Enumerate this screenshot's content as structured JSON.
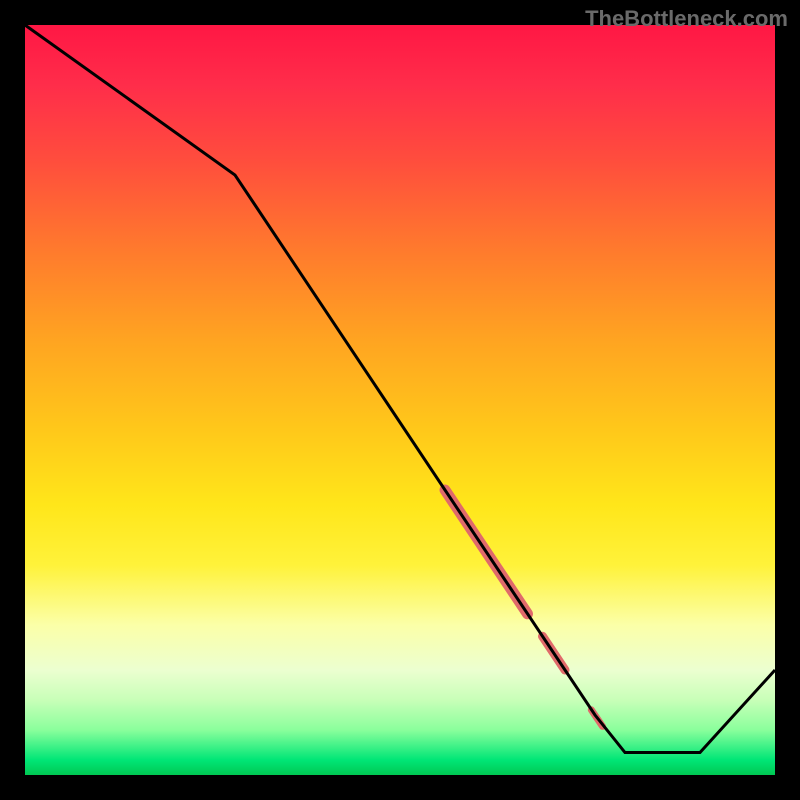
{
  "watermark": "TheBottleneck.com",
  "chart_data": {
    "type": "line",
    "title": "",
    "xlabel": "",
    "ylabel": "",
    "xlim": [
      0,
      100
    ],
    "ylim": [
      0,
      100
    ],
    "x": [
      0,
      28,
      76,
      80,
      90,
      100
    ],
    "values": [
      100,
      80,
      8,
      3,
      3,
      14
    ],
    "highlight_segments": [
      {
        "x0": 56,
        "y0": 38,
        "x1": 67,
        "y1": 21.5,
        "width": 11
      },
      {
        "x0": 69,
        "y0": 18.5,
        "x1": 72,
        "y1": 14,
        "width": 9
      },
      {
        "x0": 75.5,
        "y0": 8.7,
        "x1": 77,
        "y1": 6.5,
        "width": 7
      }
    ],
    "highlight_color": "#e06a6a",
    "line_color": "#000000"
  }
}
